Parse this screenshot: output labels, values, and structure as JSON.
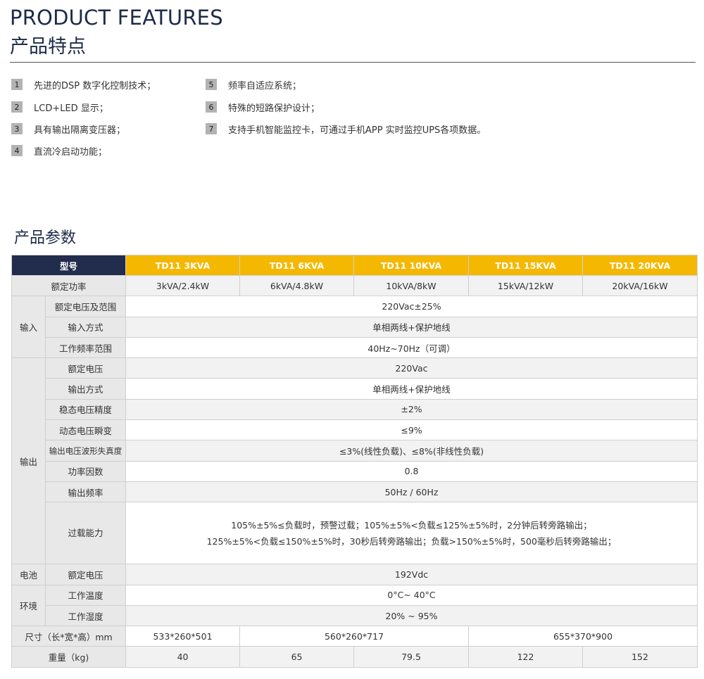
{
  "header": {
    "title_en": "PRODUCT FEATURES",
    "title_cn": "产品特点"
  },
  "features_left": [
    {
      "num": "1",
      "text": "先进的DSP 数字化控制技术；"
    },
    {
      "num": "2",
      "text": "LCD+LED 显示；"
    },
    {
      "num": "3",
      "text": "具有输出隔离变压器；"
    },
    {
      "num": "4",
      "text": "直流冷启动功能；"
    }
  ],
  "features_right": [
    {
      "num": "5",
      "text": "频率自适应系统；"
    },
    {
      "num": "6",
      "text": "特殊的短路保护设计；"
    },
    {
      "num": "7",
      "text": "支持手机智能监控卡，可通过手机APP 实时监控UPS各项数据。"
    }
  ],
  "spec": {
    "title": "产品参数",
    "model_label": "型号",
    "models": [
      "TD11 3KVA",
      "TD11 6KVA",
      "TD11 10KVA",
      "TD11 15KVA",
      "TD11 20KVA"
    ],
    "rated_power_label": "额定功率",
    "rated_power": [
      "3kVA/2.4kW",
      "6kVA/4.8kW",
      "10kVA/8kW",
      "15kVA/12kW",
      "20kVA/16kW"
    ],
    "input": {
      "category": "输入",
      "voltage_label": "额定电压及范围",
      "voltage": "220Vac±25%",
      "mode_label": "输入方式",
      "mode": "单相两线+保护地线",
      "freq_label": "工作频率范围",
      "freq": "40Hz~70Hz（可调）"
    },
    "output": {
      "category": "输出",
      "voltage_label": "额定电压",
      "voltage": "220Vac",
      "mode_label": "输出方式",
      "mode": "单相两线+保护地线",
      "accuracy_label": "稳态电压精度",
      "accuracy": "±2%",
      "transient_label": "动态电压瞬变",
      "transient": "≤9%",
      "thd_label": "输出电压波形失真度",
      "thd": "≤3%(线性负载)、≤8%(非线性负载)",
      "pf_label": "功率因数",
      "pf": "0.8",
      "freq_label": "输出频率",
      "freq": "50Hz / 60Hz",
      "overload_label": "过载能力",
      "overload_line1": "105%±5%≤负载时，预警过载；105%±5%<负载≤125%±5%时，2分钟后转旁路输出；",
      "overload_line2": "125%±5%<负载≤150%±5%时，30秒后转旁路输出；负载>150%±5%时，500毫秒后转旁路输出；"
    },
    "battery": {
      "category": "电池",
      "voltage_label": "额定电压",
      "voltage": "192Vdc"
    },
    "env": {
      "category": "环境",
      "temp_label": "工作温度",
      "temp": "0°C~ 40°C",
      "humidity_label": "工作湿度",
      "humidity": "20% ~ 95%"
    },
    "size_label": "尺寸（长*宽*高）mm",
    "sizes": [
      "533*260*501",
      "560*260*717",
      "655*370*900"
    ],
    "weight_label": "重量（kg)",
    "weights": [
      "40",
      "65",
      "79.5",
      "122",
      "152"
    ]
  }
}
